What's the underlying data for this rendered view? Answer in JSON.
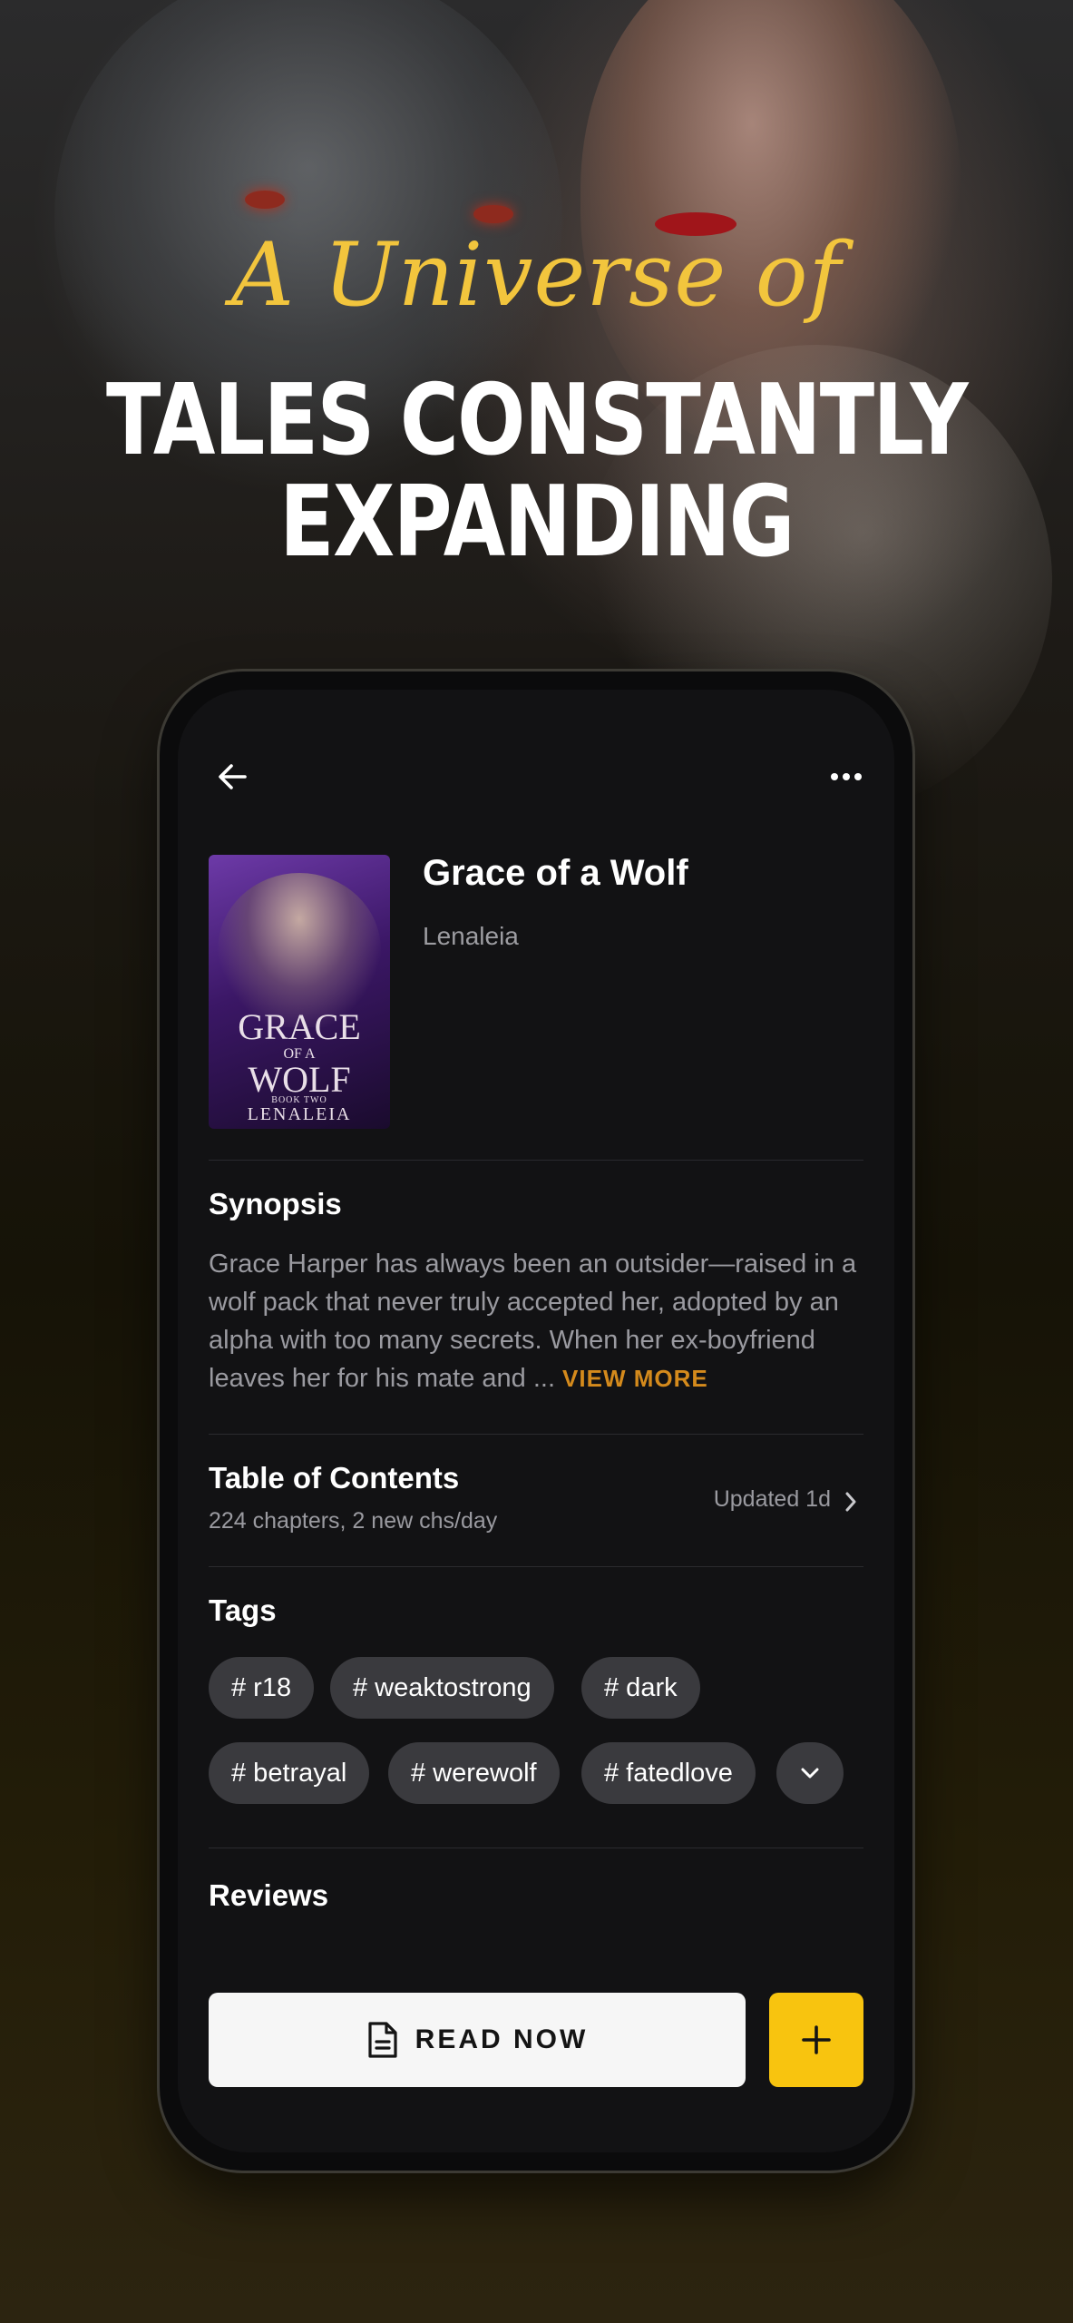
{
  "promo": {
    "script_text": "A Universe of",
    "headline_line1": "TALES CONSTANTLY",
    "headline_line2": "EXPANDING"
  },
  "header": {
    "back_icon": "arrow-left-icon",
    "more_icon": "more-horizontal-icon"
  },
  "book": {
    "title": "Grace of a Wolf",
    "author": "Lenaleia",
    "cover": {
      "title_line1": "GRACE",
      "title_line2": "OF A",
      "title_line3": "WOLF",
      "subtitle": "BOOK TWO",
      "author": "LENALEIA"
    }
  },
  "synopsis": {
    "heading": "Synopsis",
    "text": "Grace Harper has always been an outsider—raised in a wolf pack that never truly accepted her, adopted by an alpha with too many secrets. When her ex-boyfriend leaves her for his mate and ...",
    "view_more": "VIEW MORE"
  },
  "toc": {
    "heading": "Table of Contents",
    "subtitle": "224 chapters, 2 new chs/day",
    "updated": "Updated 1d"
  },
  "tags": {
    "heading": "Tags",
    "items": [
      "# r18",
      "# weaktostrong",
      "# dark",
      "# betrayal",
      "# werewolf",
      "# fatedlove"
    ]
  },
  "reviews": {
    "heading": "Reviews"
  },
  "actions": {
    "read_label": "READ NOW",
    "read_icon": "document-icon",
    "add_icon": "plus-icon"
  },
  "colors": {
    "accent_yellow": "#f8c40f",
    "view_more_orange": "#d48a1c",
    "script_gold": "#f2c53d",
    "screen_bg": "#121214"
  }
}
